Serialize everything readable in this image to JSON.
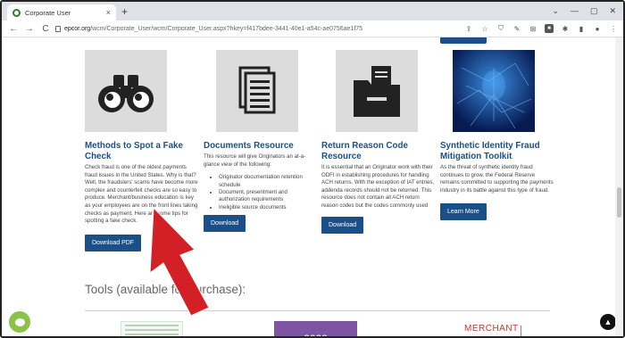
{
  "browser": {
    "tab_title": "Corporate User",
    "tab_close": "×",
    "new_tab": "+",
    "window_controls": [
      "⌄",
      "—",
      "▢",
      "✕"
    ],
    "nav": {
      "back": "←",
      "forward": "→",
      "reload": "C"
    },
    "url_domain": "epcor.org",
    "url_path": "/wcm/Corporate_User/wcm/Corporate_User.aspx?hkey=f417bdee-3441-40e1-a54c-ae0756ae1f75",
    "toolbar_icons": [
      "share-icon",
      "star-icon",
      "shield-icon",
      "extension-icon",
      "extension-icon",
      "extension-icon",
      "puzzle-icon",
      "sidebar-icon",
      "profile-icon",
      "menu-icon"
    ]
  },
  "cards": [
    {
      "title": "Methods to Spot a Fake Check",
      "body": "Check fraud is one of the oldest payments fraud issues in the United States. Why is that? Well, the fraudsters' scams have become more complex and counterfeit checks are so easy to produce. Merchant/business education is key as your employees are on the front lines taking checks as payment. Here are some tips for spotting a fake check.",
      "button": "Download PDF",
      "icon": "binoculars-icon"
    },
    {
      "title": "Documents Resource",
      "body": "This resource will give Originators an at-a-glance view of the following:",
      "bullets": [
        "Originator documentation retention schedule",
        "Document, presentment and authorization requirements",
        "Ineligible source documents"
      ],
      "button": "Download",
      "icon": "document-icon"
    },
    {
      "title": "Return Reason Code Resource",
      "body": "It is essential that an Originator work with their ODFI in establishing procedures for handling ACH returns. With the exception of IAT entries, addenda records should not be returned. This resource does not contain all ACH return reason codes but the codes commonly used",
      "button": "Download",
      "icon": "folder-icon"
    },
    {
      "title": "Synthetic Identity Fraud Mitigation Toolkit",
      "body": "As the threat of synthetic identity fraud continues to grow, the Federal Reserve remains committed to supporting the payments industry in its battle against this type of fraud.",
      "button": "Learn More",
      "icon": "digital-identity-image"
    }
  ],
  "tools_heading": "Tools (available for purchase):",
  "tools_thumbs": {
    "second": "2022",
    "third": "MERCHANT"
  },
  "colors": {
    "accent": "#1b4f88",
    "arrow": "#d32027"
  }
}
